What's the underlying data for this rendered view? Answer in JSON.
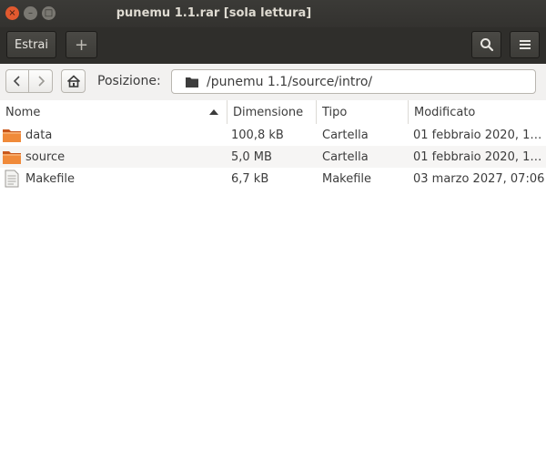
{
  "window": {
    "title": "punemu 1.1.rar [sola lettura]",
    "close_label": "×",
    "min_label": "–",
    "max_label": "□"
  },
  "toolbar": {
    "extract_label": "Estrai",
    "add_label": "+",
    "search_icon": "search-icon",
    "menu_icon": "hamburger-menu-icon"
  },
  "location": {
    "back_icon": "chevron-left-icon",
    "forward_icon": "chevron-right-icon",
    "home_icon": "home-icon",
    "label": "Posizione:",
    "path": "/punemu 1.1/source/intro/"
  },
  "columns": {
    "name": "Nome",
    "size": "Dimensione",
    "type": "Tipo",
    "modified": "Modificato"
  },
  "files": [
    {
      "name": "data",
      "size": "100,8 kB",
      "type": "Cartella",
      "modified": "01 febbraio 2020, 1…",
      "icon": "folder-icon"
    },
    {
      "name": "source",
      "size": "5,0 MB",
      "type": "Cartella",
      "modified": "01 febbraio 2020, 1…",
      "icon": "folder-icon"
    },
    {
      "name": "Makefile",
      "size": "6,7 kB",
      "type": "Makefile",
      "modified": "03 marzo 2027, 07:06",
      "icon": "text-file-icon"
    }
  ],
  "colors": {
    "titlebar": "#3b3a37",
    "close_button": "#e1592f",
    "folder": "#e8782f",
    "row_alt": "#f6f5f4"
  }
}
